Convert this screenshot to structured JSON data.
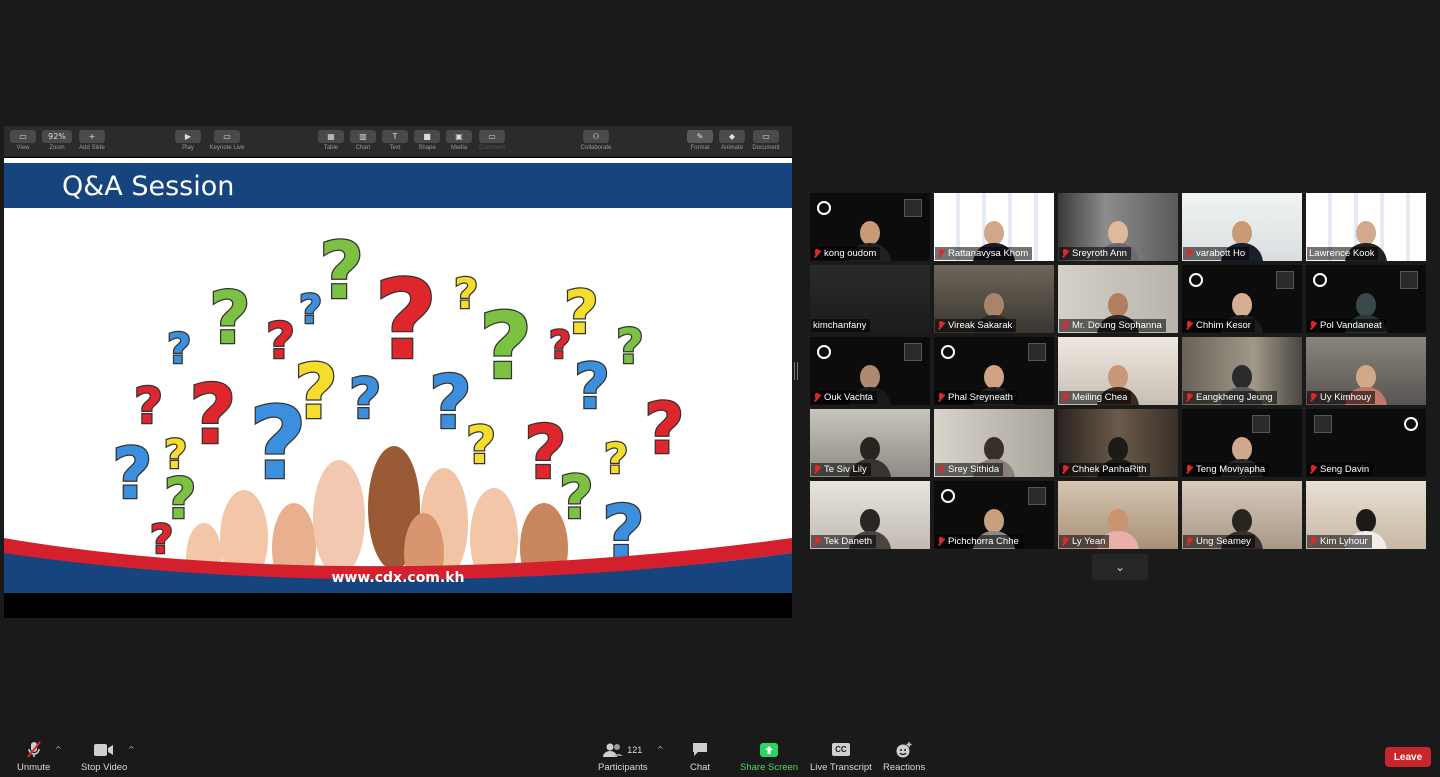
{
  "keynote_toolbar": {
    "zoom_value": "92%",
    "buttons": [
      {
        "label": "View"
      },
      {
        "label": "Zoom"
      },
      {
        "label": "Add Slide"
      },
      {
        "label": "Play"
      },
      {
        "label": "Keynote Live"
      },
      {
        "label": "Table"
      },
      {
        "label": "Chart"
      },
      {
        "label": "Text"
      },
      {
        "label": "Shape"
      },
      {
        "label": "Media"
      },
      {
        "label": "Comment"
      },
      {
        "label": "Collaborate"
      },
      {
        "label": "Format"
      },
      {
        "label": "Animate"
      },
      {
        "label": "Document"
      }
    ]
  },
  "slide": {
    "title": "Q&A Session",
    "url": "www.cdx.com.kh"
  },
  "gallery": {
    "participants": [
      {
        "name": "kong oudom"
      },
      {
        "name": "Rattanavysa Khom"
      },
      {
        "name": "Sreyroth Ann"
      },
      {
        "name": "varabott Ho"
      },
      {
        "name": "Lawrence Kook"
      },
      {
        "name": "kimchanfany"
      },
      {
        "name": "Vireak Sakarak"
      },
      {
        "name": "Mr. Doung Sophanna"
      },
      {
        "name": "Chhim Kesor"
      },
      {
        "name": "Pol Vandaneat"
      },
      {
        "name": "Ouk Vachta"
      },
      {
        "name": "Phal Sreyneath"
      },
      {
        "name": "Meiling Chea"
      },
      {
        "name": "Eangkheng Jeung"
      },
      {
        "name": "Uy Kimhouy"
      },
      {
        "name": "Te Siv Lily"
      },
      {
        "name": "Srey Sithida"
      },
      {
        "name": "Chhek PanhaRith"
      },
      {
        "name": "Teng Moviyapha"
      },
      {
        "name": "Seng Davin"
      },
      {
        "name": "Tek Daneth"
      },
      {
        "name": "Pichchorra Chhe"
      },
      {
        "name": "Ly Yean"
      },
      {
        "name": "Ung Seamey"
      },
      {
        "name": "Kim Lyhour"
      }
    ]
  },
  "bottombar": {
    "unmute_label": "Unmute",
    "stop_video_label": "Stop Video",
    "participants_label": "Participants",
    "participants_count": "121",
    "chat_label": "Chat",
    "share_screen_label": "Share Screen",
    "live_transcript_label": "Live Transcript",
    "live_transcript_icon_text": "CC",
    "reactions_label": "Reactions",
    "leave_label": "Leave"
  },
  "colors": {
    "slide_blue": "#16447f",
    "slide_red": "#d4202c",
    "share_green": "#2bd561",
    "leave_red": "#c8262b",
    "active_speaker": "#d7e63c"
  }
}
